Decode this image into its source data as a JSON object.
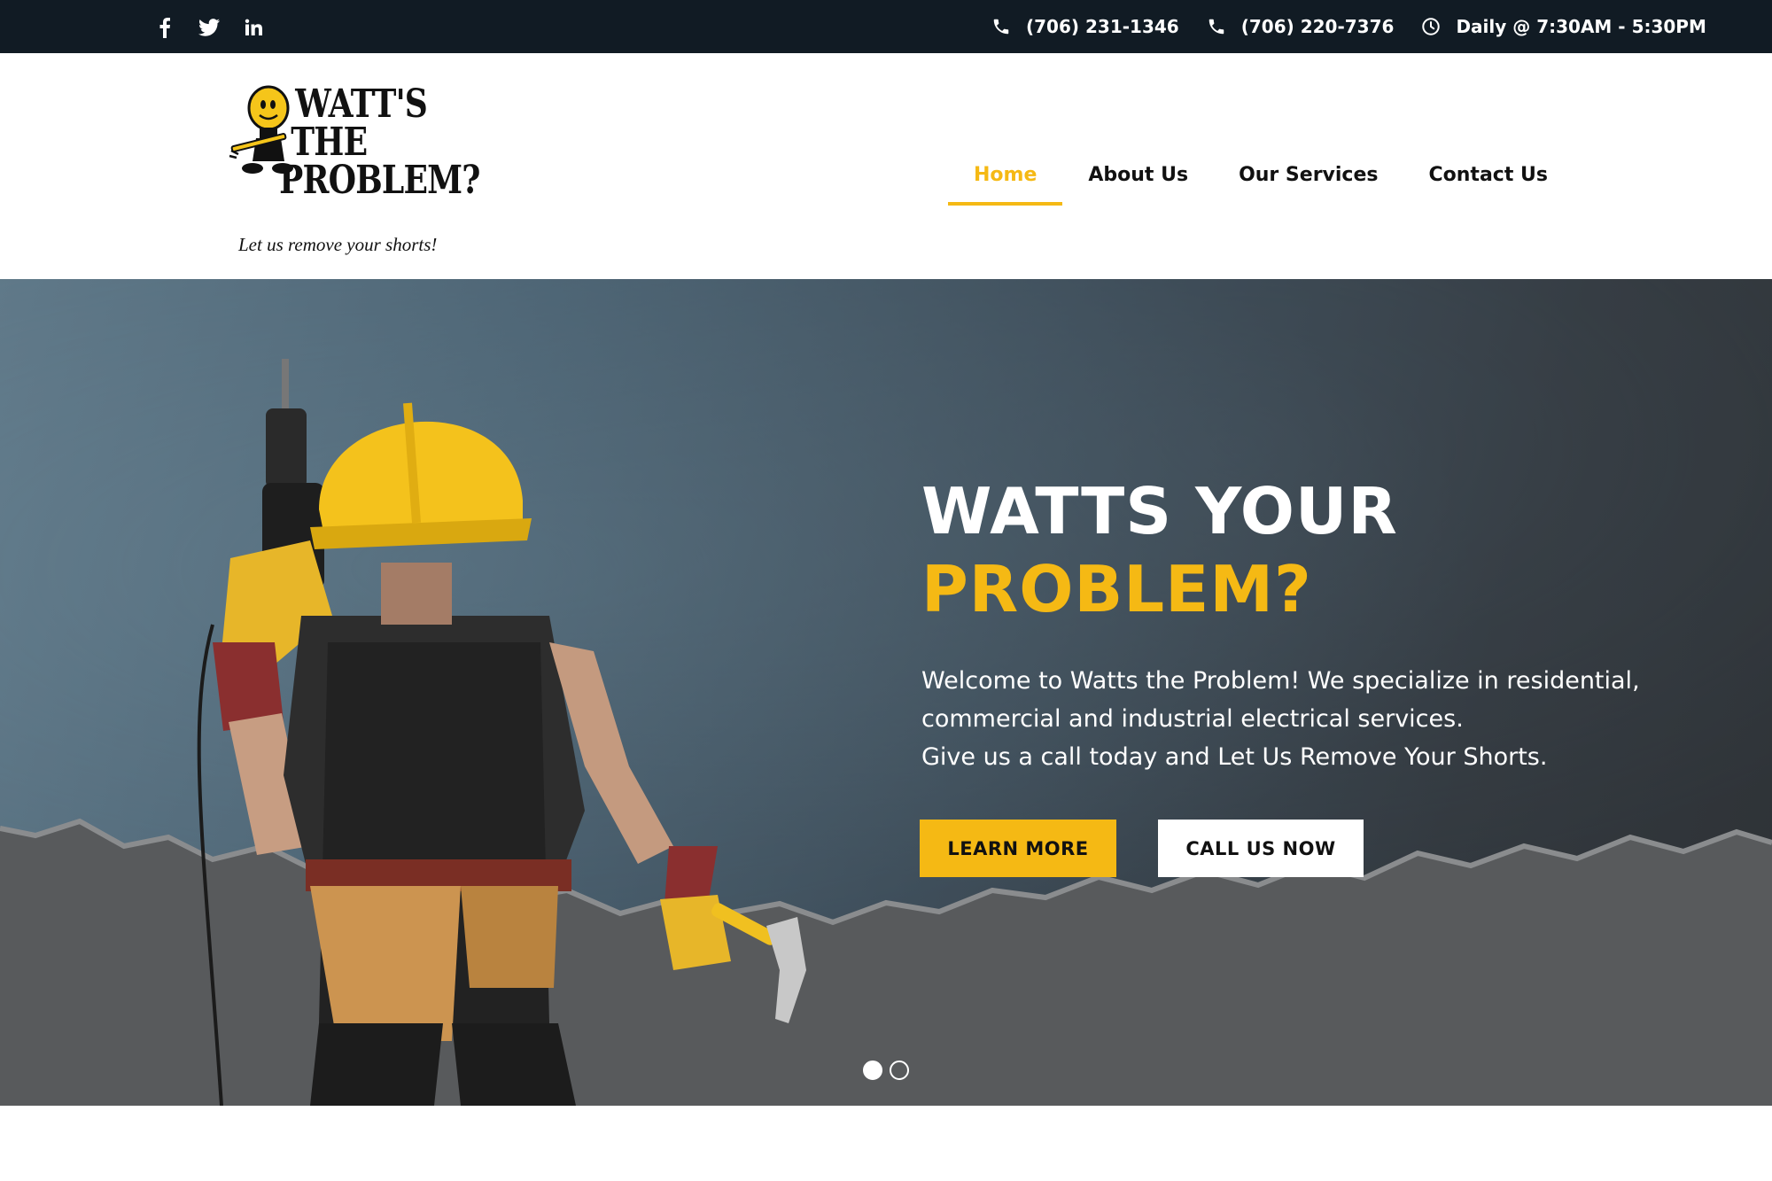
{
  "topbar": {
    "social": [
      {
        "icon": "facebook-icon"
      },
      {
        "icon": "twitter-icon"
      },
      {
        "icon": "linkedin-icon"
      }
    ],
    "phone1": "(706) 231-1346",
    "phone2": "(706) 220-7376",
    "hours": "Daily @ 7:30AM - 5:30PM"
  },
  "logo": {
    "line1": "WATT'S",
    "line2": "THE",
    "line3": "PROBLEM?",
    "tagline": "Let us remove your shorts!"
  },
  "nav": {
    "items": [
      {
        "label": "Home",
        "active": true
      },
      {
        "label": "About Us",
        "active": false
      },
      {
        "label": "Our Services",
        "active": false
      },
      {
        "label": "Contact Us",
        "active": false
      }
    ]
  },
  "hero": {
    "title_line1": "WATTS YOUR",
    "title_line2": "PROBLEM?",
    "text_line1": "Welcome to Watts the Problem! We specialize in residential,",
    "text_line2": "commercial and industrial electrical services.",
    "text_line3": "Give us a call today and Let Us Remove Your Shorts.",
    "learn_more": "LEARN MORE",
    "call_us": "CALL US NOW",
    "slides": 2,
    "active_slide": 1
  },
  "colors": {
    "accent": "#f5b914",
    "topbar": "#111b24",
    "text": "#111111"
  }
}
